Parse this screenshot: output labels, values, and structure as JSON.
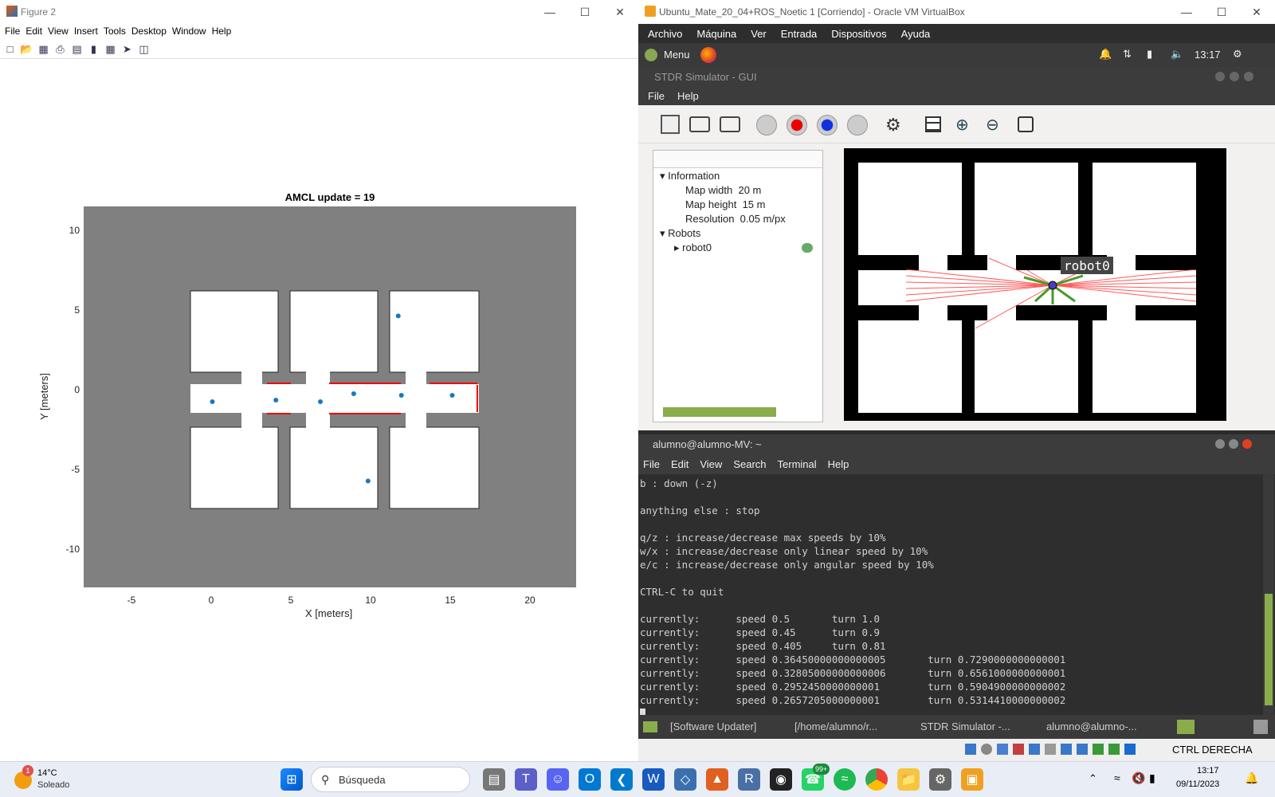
{
  "figure_window": {
    "title": "Figure 2",
    "menu": [
      "File",
      "Edit",
      "View",
      "Insert",
      "Tools",
      "Desktop",
      "Window",
      "Help"
    ],
    "plot": {
      "title": "AMCL update = 19",
      "xlabel": "X [meters]",
      "ylabel": "Y [meters]",
      "xticks": [
        "-5",
        "0",
        "5",
        "10",
        "15",
        "20"
      ],
      "yticks": [
        "10",
        "5",
        "0",
        "-5",
        "-10"
      ]
    }
  },
  "chart_data": {
    "type": "scatter",
    "title": "AMCL update = 19",
    "xlabel": "X [meters]",
    "ylabel": "Y [meters]",
    "xlim": [
      -8,
      23
    ],
    "ylim": [
      -12.5,
      11.5
    ],
    "series": [
      {
        "values": [
          [
            0.1,
            -0.8
          ],
          [
            4.1,
            -0.7
          ],
          [
            6.9,
            -0.8
          ],
          [
            9.0,
            -0.3
          ],
          [
            12.0,
            -0.4
          ],
          [
            15.2,
            -0.4
          ],
          [
            11.8,
            4.6
          ],
          [
            9.9,
            -5.8
          ]
        ]
      }
    ]
  },
  "vbox": {
    "title": "Ubuntu_Mate_20_04+ROS_Noetic 1 [Corriendo] - Oracle VM VirtualBox",
    "menu": [
      "Archivo",
      "Máquina",
      "Ver",
      "Entrada",
      "Dispositivos",
      "Ayuda"
    ],
    "mate_menu": "Menu",
    "clock": "13:17",
    "stdr_title": "STDR Simulator - GUI",
    "stdr_menu": [
      "File",
      "Help"
    ],
    "tree": {
      "information": "Information",
      "map_width_label": "Map width",
      "map_width": "20 m",
      "map_height_label": "Map height",
      "map_height": "15 m",
      "resolution_label": "Resolution",
      "resolution": "0.05 m/px",
      "robots": "Robots",
      "robot0": "robot0"
    },
    "robot_label": "robot0",
    "terminal": {
      "title": "alumno@alumno-MV: ~",
      "menu": [
        "File",
        "Edit",
        "View",
        "Search",
        "Terminal",
        "Help"
      ],
      "lines": [
        "b : down (-z)",
        "",
        "anything else : stop",
        "",
        "q/z : increase/decrease max speeds by 10%",
        "w/x : increase/decrease only linear speed by 10%",
        "e/c : increase/decrease only angular speed by 10%",
        "",
        "CTRL-C to quit",
        "",
        "currently:      speed 0.5       turn 1.0",
        "currently:      speed 0.45      turn 0.9",
        "currently:      speed 0.405     turn 0.81",
        "currently:      speed 0.36450000000000005       turn 0.7290000000000001",
        "currently:      speed 0.32805000000000006       turn 0.6561000000000001",
        "currently:      speed 0.2952450000000001        turn 0.5904900000000002",
        "currently:      speed 0.2657205000000001        turn 0.5314410000000002"
      ]
    },
    "mate_tasks": [
      "[Software Updater]",
      "[/home/alumno/r...",
      "STDR Simulator -...",
      "alumno@alumno-..."
    ],
    "host_key": "CTRL DERECHA"
  },
  "taskbar": {
    "weather_temp": "14°C",
    "weather_text": "Soleado",
    "weather_badge": "1",
    "search_placeholder": "Búsqueda",
    "whatsapp_badge": "99+",
    "time": "13:17",
    "date": "09/11/2023"
  }
}
